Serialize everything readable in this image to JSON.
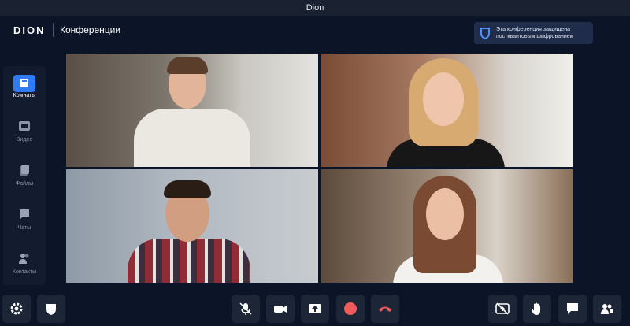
{
  "window": {
    "title": "Dion"
  },
  "header": {
    "logo": "DION",
    "title": "Конференции",
    "security_line1": "Эта конференция защищена",
    "security_line2": "постквантовым шифрованием"
  },
  "sidebar": {
    "items": [
      {
        "label": "Комнаты",
        "icon": "rooms-icon",
        "active": true
      },
      {
        "label": "Видео",
        "icon": "video-library-icon",
        "active": false
      },
      {
        "label": "Файлы",
        "icon": "files-icon",
        "active": false
      },
      {
        "label": "Чаты",
        "icon": "chat-icon",
        "active": false
      },
      {
        "label": "Контакты",
        "icon": "contacts-icon",
        "active": false
      }
    ]
  },
  "participants": [
    {
      "tile": "young-man-white-sweater"
    },
    {
      "tile": "blonde-woman-smiling"
    },
    {
      "tile": "man-plaid-shirt"
    },
    {
      "tile": "woman-white-blouse"
    }
  ],
  "toolbar": {
    "left": [
      "settings-icon",
      "security-shield-icon"
    ],
    "center": [
      "mic-muted-icon",
      "camera-icon",
      "share-screen-icon",
      "record-icon",
      "hang-up-icon"
    ],
    "right": [
      "screen-share-off-icon",
      "raise-hand-icon",
      "chat-icon",
      "participants-icon"
    ]
  },
  "colors": {
    "accent": "#2d7cf6",
    "record": "#ef5b5b",
    "hangup": "#ef5b5b"
  }
}
